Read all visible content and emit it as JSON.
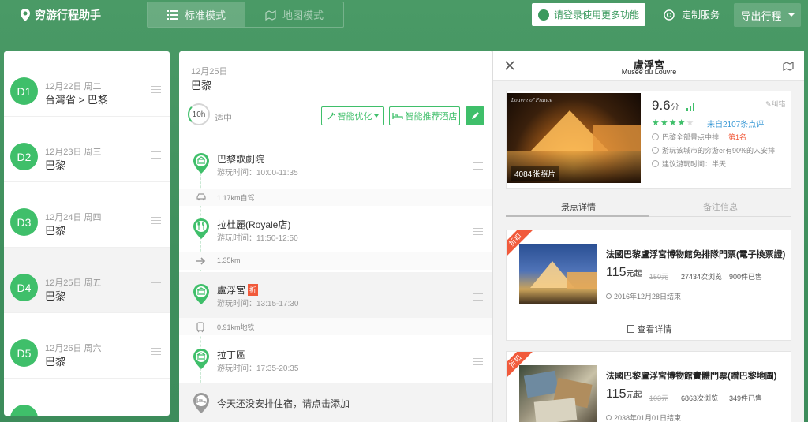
{
  "app": {
    "name": "穷游行程助手"
  },
  "modes": {
    "standard": "标准模式",
    "map": "地图模式"
  },
  "header": {
    "login": "请登录使用更多功能",
    "custom": "定制服务",
    "export": "导出行程"
  },
  "days": [
    {
      "badge": "D1",
      "date": "12月22日 周二",
      "place": "台灣省 > 巴黎"
    },
    {
      "badge": "D2",
      "date": "12月23日 周三",
      "place": "巴黎"
    },
    {
      "badge": "D3",
      "date": "12月24日 周四",
      "place": "巴黎"
    },
    {
      "badge": "D4",
      "date": "12月25日 周五",
      "place": "巴黎"
    },
    {
      "badge": "D5",
      "date": "12月26日 周六",
      "place": "巴黎"
    }
  ],
  "schedule": {
    "date": "12月25日",
    "city": "巴黎",
    "hours": "10h",
    "hours_note": "适中",
    "optimize": "智能优化",
    "hotel": "智能推荐酒店",
    "spots": [
      {
        "name": "巴黎歌劇院",
        "time": "游玩时间：10:00-11:35",
        "discount": ""
      },
      {
        "name": "拉杜麗(Royale店)",
        "time": "游玩时间：11:50-12:50",
        "discount": ""
      },
      {
        "name": "盧浮宮",
        "time": "游玩时间：13:15-17:30",
        "discount": "折"
      },
      {
        "name": "拉丁區",
        "time": "游玩时间：17:35-20:35",
        "discount": ""
      }
    ],
    "transports": [
      {
        "label": "1.17km自驾",
        "icon": "car-icon"
      },
      {
        "label": "1.35km",
        "icon": "arrow-right-icon"
      },
      {
        "label": "0.91km地铁",
        "icon": "subway-icon"
      }
    ],
    "no_hotel": "今天还没安排住宿，请点击添加"
  },
  "detail": {
    "title": "盧浮宮",
    "subtitle": "Musée du Louvre",
    "photo_caption": "Louvre of France",
    "photos": "4084张照片",
    "score": "9.6",
    "score_unit": "分",
    "report": "纠错",
    "stars_filled": 4,
    "stars_total": 5,
    "reviews": "来自2107条点评",
    "rank_text": "巴黎全部景点中排",
    "rank": "第1名",
    "visitors_text": "游玩该城市的穷游er有90%的人安排",
    "duration": "建议游玩时间：半天",
    "tabs": {
      "info": "景点详情",
      "notes": "备注信息"
    },
    "tickets": [
      {
        "ribbon": "折扣",
        "name": "法國巴黎盧浮宮博物館免排隊門票(電子換票證)",
        "price": "115",
        "price_unit": "元起",
        "orig": "150元",
        "views": "27434次浏览",
        "sold": "900件已售",
        "end": "2016年12月28日结束",
        "more": "查看详情"
      },
      {
        "ribbon": "折扣",
        "name": "法國巴黎盧浮宮博物館實體門票(贈巴黎地圖)",
        "price": "115",
        "price_unit": "元起",
        "orig": "103元",
        "views": "6863次浏览",
        "sold": "349件已售",
        "end": "2038年01月01日结束",
        "more": ""
      }
    ]
  }
}
